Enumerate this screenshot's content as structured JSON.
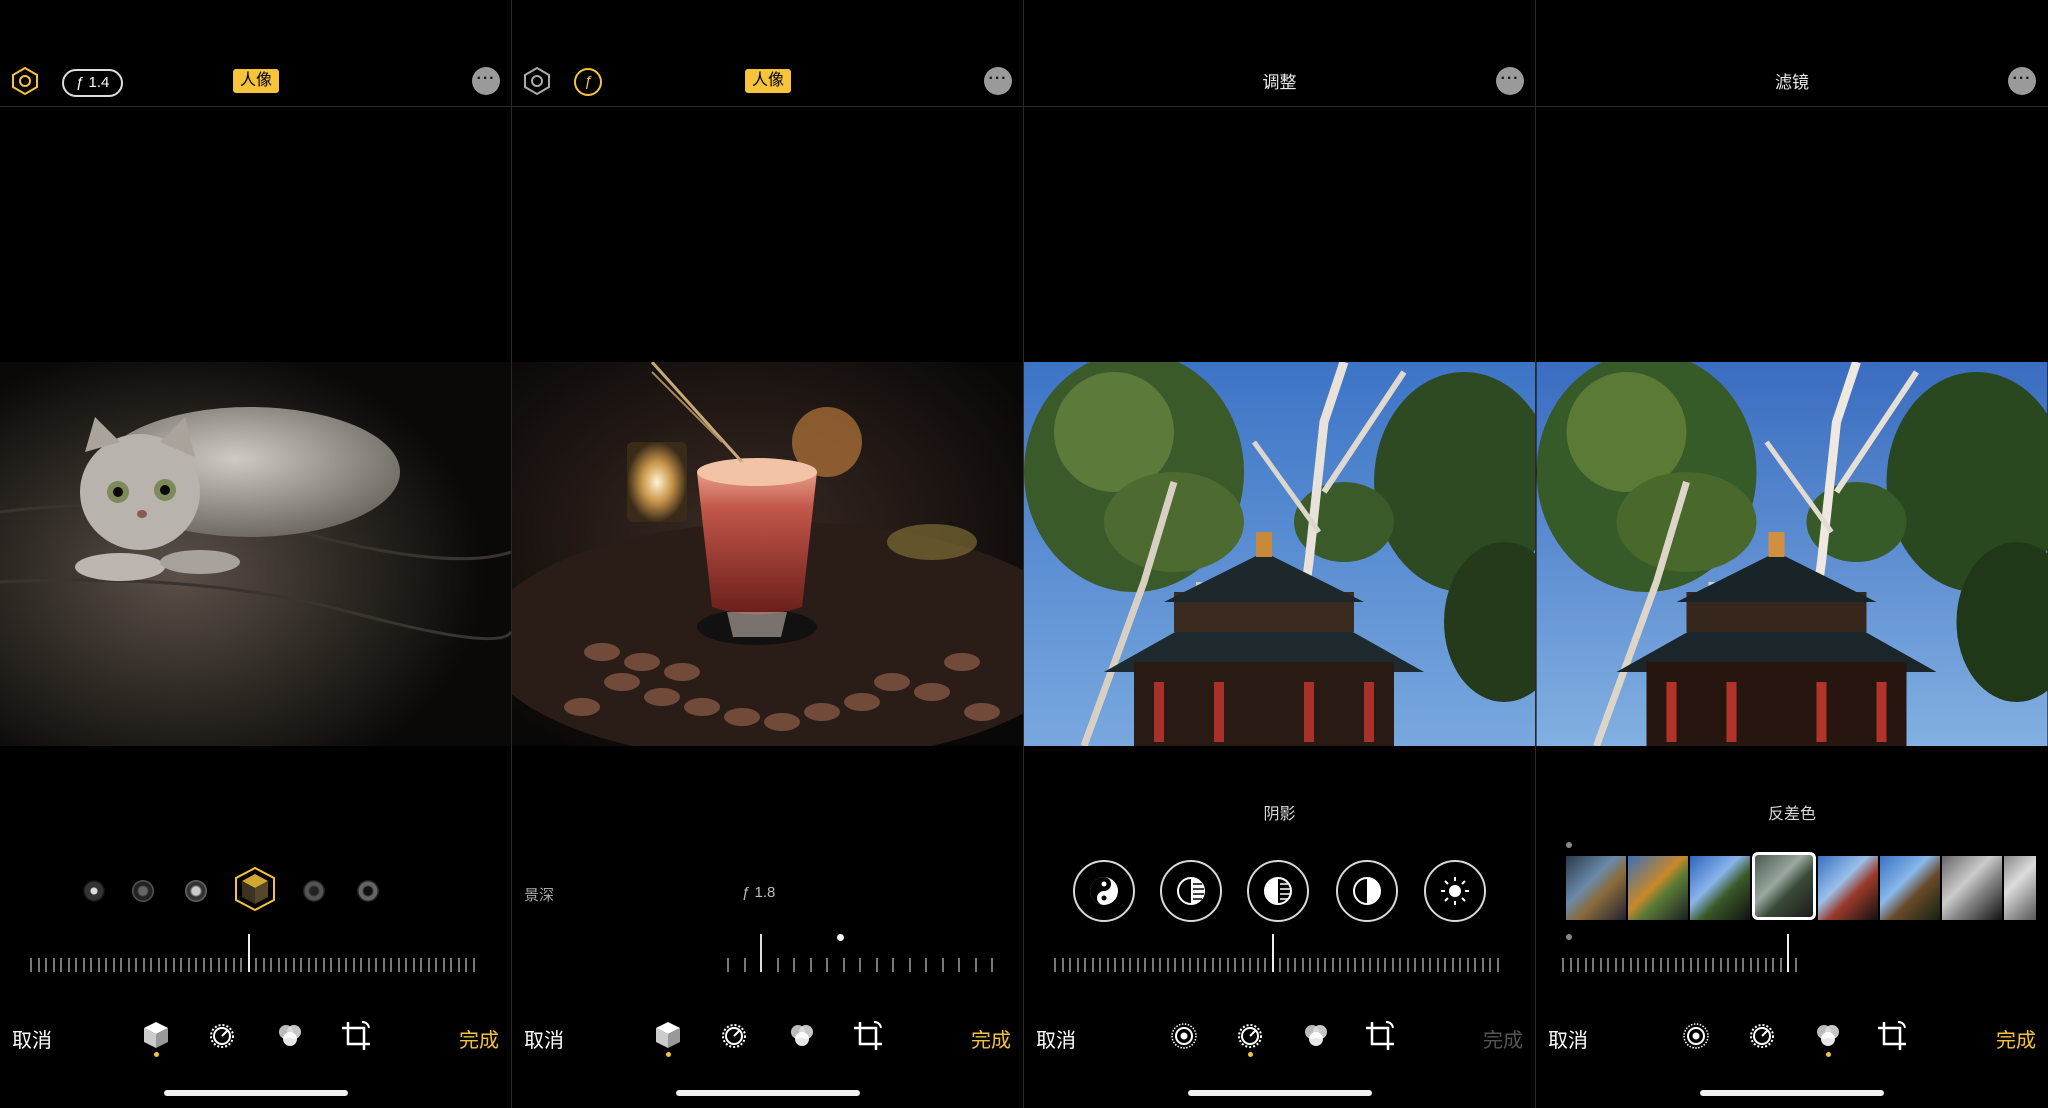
{
  "panels": [
    {
      "id": "portrait-light",
      "badge": "人像",
      "f_label": "ƒ 1.4",
      "cancel": "取消",
      "done": "完成"
    },
    {
      "id": "portrait-depth",
      "badge": "人像",
      "f_icon": "ƒ",
      "depth_label": "景深",
      "depth_value": "ƒ 1.8",
      "cancel": "取消",
      "done": "完成"
    },
    {
      "id": "adjust",
      "title": "调整",
      "caption": "阴影",
      "cancel": "取消",
      "done": "完成"
    },
    {
      "id": "filters",
      "title": "滤镜",
      "caption": "反差色",
      "cancel": "取消",
      "done": "完成"
    }
  ],
  "icons": {
    "tools": [
      "portrait-cube-icon",
      "adjust-dial-icon",
      "filters-circles-icon",
      "crop-rotate-icon"
    ],
    "more": "ellipsis-icon"
  },
  "colors": {
    "accent": "#f6c43a",
    "disabled": "#555555"
  }
}
